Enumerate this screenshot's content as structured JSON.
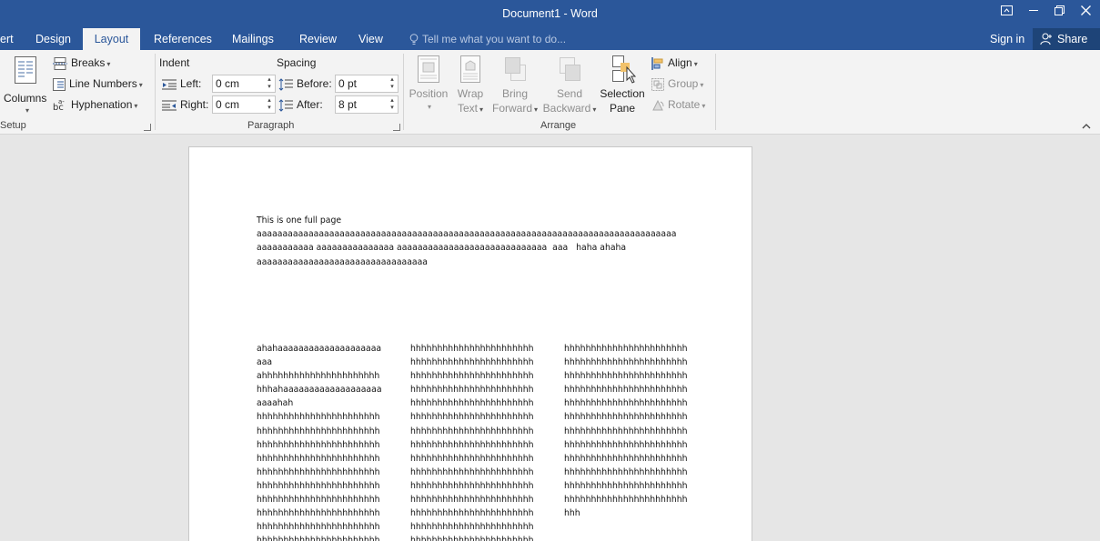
{
  "window": {
    "title": "Document1 - Word"
  },
  "tabs": [
    {
      "label": "ert"
    },
    {
      "label": "Design"
    },
    {
      "label": "Layout"
    },
    {
      "label": "References"
    },
    {
      "label": "Mailings"
    },
    {
      "label": "Review"
    },
    {
      "label": "View"
    }
  ],
  "tellme": {
    "placeholder": "Tell me what you want to do..."
  },
  "account": {
    "signin": "Sign in",
    "share": "Share"
  },
  "ribbon": {
    "page_setup": {
      "columns": "Columns",
      "breaks": "Breaks",
      "line_numbers": "Line Numbers",
      "hyphenation": "Hyphenation",
      "group_label": "Setup"
    },
    "paragraph": {
      "indent_header": "Indent",
      "spacing_header": "Spacing",
      "left_label": "Left:",
      "right_label": "Right:",
      "before_label": "Before:",
      "after_label": "After:",
      "left_value": "0 cm",
      "right_value": "0 cm",
      "before_value": "0 pt",
      "after_value": "8 pt",
      "group_label": "Paragraph"
    },
    "arrange": {
      "position": "Position",
      "wrap_text_1": "Wrap",
      "wrap_text_2": "Text",
      "bring_forward_1": "Bring",
      "bring_forward_2": "Forward",
      "send_backward_1": "Send",
      "send_backward_2": "Backward",
      "selection_pane_1": "Selection",
      "selection_pane_2": "Pane",
      "align": "Align",
      "group": "Group",
      "rotate": "Rotate",
      "group_label": "Arrange"
    }
  },
  "document": {
    "lines": [
      "This is one full page",
      "aaaaaaaaaaaaaaaaaaaaaaaaaaaaaaaaaaaaaaaaaaaaaaaaaaaaaaaaaaaaaaaaaaaaaaaaaaaaaaaaa",
      "aaaaaaaaaaa aaaaaaaaaaaaaaa aaaaaaaaaaaaaaaaaaaaaaaaaaaaa  aaa   haha ahaha",
      "aaaaaaaaaaaaaaaaaaaaaaaaaaaaaaaaa"
    ],
    "columns": [
      [
        "ahahaaaaaaaaaaaaaaaaaaaa",
        "aaa",
        "ahhhhhhhhhhhhhhhhhhhhhh",
        "hhhahaaaaaaaaaaaaaaaaaaa",
        "aaaahah",
        "hhhhhhhhhhhhhhhhhhhhhhh",
        "hhhhhhhhhhhhhhhhhhhhhhh",
        "hhhhhhhhhhhhhhhhhhhhhhh",
        "hhhhhhhhhhhhhhhhhhhhhhh",
        "hhhhhhhhhhhhhhhhhhhhhhh",
        "hhhhhhhhhhhhhhhhhhhhhhh",
        "hhhhhhhhhhhhhhhhhhhhhhh",
        "hhhhhhhhhhhhhhhhhhhhhhh",
        "hhhhhhhhhhhhhhhhhhhhhhh",
        "hhhhhhhhhhhhhhhhhhhhhhh"
      ],
      [
        "hhhhhhhhhhhhhhhhhhhhhhh",
        "hhhhhhhhhhhhhhhhhhhhhhh",
        "hhhhhhhhhhhhhhhhhhhhhhh",
        "hhhhhhhhhhhhhhhhhhhhhhh",
        "hhhhhhhhhhhhhhhhhhhhhhh",
        "hhhhhhhhhhhhhhhhhhhhhhh",
        "hhhhhhhhhhhhhhhhhhhhhhh",
        "hhhhhhhhhhhhhhhhhhhhhhh",
        "hhhhhhhhhhhhhhhhhhhhhhh",
        "hhhhhhhhhhhhhhhhhhhhhhh",
        "hhhhhhhhhhhhhhhhhhhhhhh",
        "hhhhhhhhhhhhhhhhhhhhhhh",
        "hhhhhhhhhhhhhhhhhhhhhhh",
        "hhhhhhhhhhhhhhhhhhhhhhh",
        "hhhhhhhhhhhhhhhhhhhhhhh"
      ],
      [
        "hhhhhhhhhhhhhhhhhhhhhhh",
        "hhhhhhhhhhhhhhhhhhhhhhh",
        "hhhhhhhhhhhhhhhhhhhhhhh",
        "hhhhhhhhhhhhhhhhhhhhhhh",
        "hhhhhhhhhhhhhhhhhhhhhhh",
        "hhhhhhhhhhhhhhhhhhhhhhh",
        "hhhhhhhhhhhhhhhhhhhhhhh",
        "hhhhhhhhhhhhhhhhhhhhhhh",
        "hhhhhhhhhhhhhhhhhhhhhhh",
        "hhhhhhhhhhhhhhhhhhhhhhh",
        "hhhhhhhhhhhhhhhhhhhhhhh",
        "hhhhhhhhhhhhhhhhhhhhhhh",
        "hhh"
      ]
    ]
  },
  "colors": {
    "titlebar": "#2b579a",
    "ribbon": "#f3f3f3",
    "docbg": "#e6e6e6"
  }
}
